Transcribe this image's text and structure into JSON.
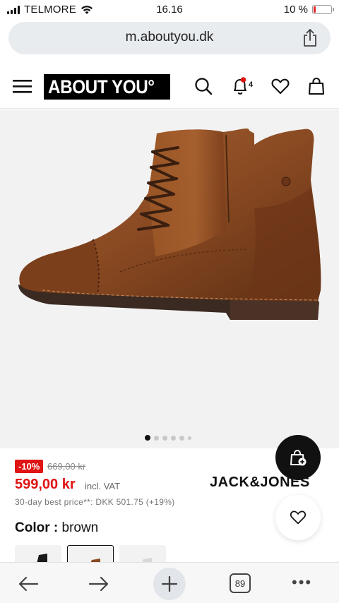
{
  "status_bar": {
    "carrier": "TELMORE",
    "time": "16.16",
    "battery": "10 %",
    "battery_level_pct": 10
  },
  "browser": {
    "url": "m.aboutyou.dk",
    "tab_count": "89"
  },
  "header": {
    "logo_text": "ABOUT YOU°",
    "notification_count": "4"
  },
  "gallery": {
    "image_count": 6,
    "active_index": 0,
    "image_alt": "brown leather lace-up boot"
  },
  "product": {
    "discount": "-10%",
    "old_price": "669,00 kr",
    "price": "599,00 kr",
    "vat_note": "incl. VAT",
    "best_price_note": "30-day best price**: DKK 501.75 (+19%)",
    "brand": "JACK&JONES",
    "color_label": "Color :",
    "color_value": "brown"
  },
  "colors": {
    "accent_red": "#e01414",
    "boot_brown": "#8a4a22",
    "fab_dark": "#111111"
  }
}
